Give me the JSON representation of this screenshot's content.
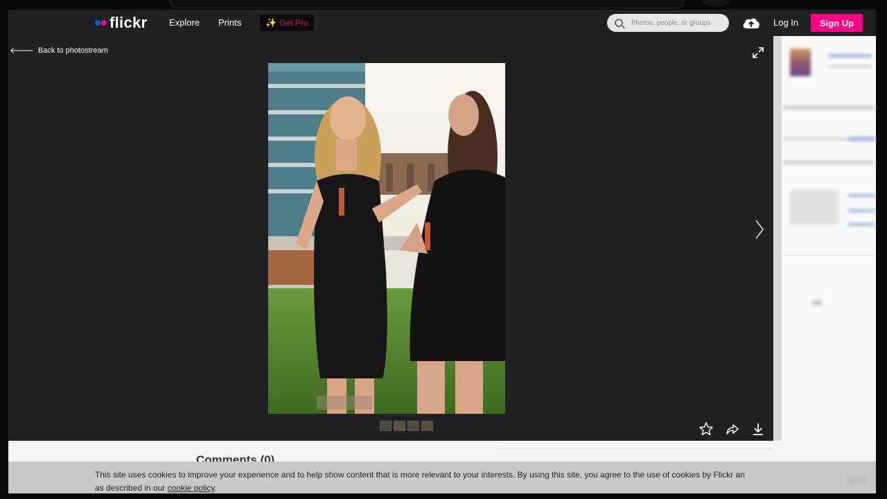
{
  "header": {
    "logo_text": "flickr",
    "nav": [
      "Explore",
      "Prints"
    ],
    "get_pro": "Get Pro",
    "search_placeholder": "Photos, people, or groups",
    "login": "Log In",
    "signup": "Sign Up"
  },
  "viewer": {
    "back_label": "Back to photostream",
    "thumbnail_count": 4
  },
  "comments": {
    "title": "Comments (0)"
  },
  "cookie_banner": {
    "text_line1": "This site uses cookies to improve your experience and to help show content that is more relevant to your interests. By using this site, you agree to the use of cookies by Flickr an",
    "text_line2_prefix": "as described in our ",
    "link": "cookie policy",
    "text_line2_suffix": "."
  },
  "colors": {
    "accent_pink": "#ff0084",
    "accent_blue": "#0063dc",
    "viewer_bg": "#212124"
  }
}
